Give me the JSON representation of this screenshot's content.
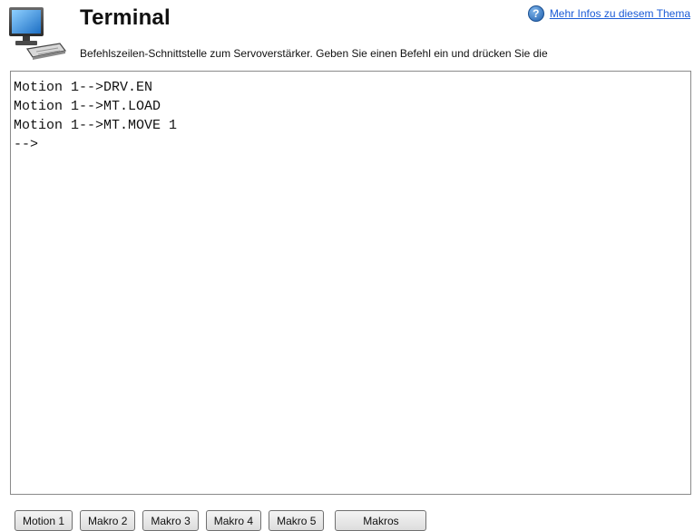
{
  "header": {
    "icon": "computer-terminal-icon",
    "title": "Terminal",
    "subtitle": "Befehlszeilen-Schnittstelle zum Servoverstärker. Geben Sie einen Befehl ein und drücken Sie die",
    "help_icon": "question-icon",
    "help_link": "Mehr Infos zu diesem Thema"
  },
  "terminal": {
    "lines": [
      "Motion 1-->DRV.EN",
      "Motion 1-->MT.LOAD",
      "Motion 1-->MT.MOVE 1",
      "-->"
    ]
  },
  "buttons": {
    "macro1": "Motion 1",
    "macro2": "Makro 2",
    "macro3": "Makro 3",
    "macro4": "Makro 4",
    "macro5": "Makro 5",
    "macros": "Makros"
  }
}
